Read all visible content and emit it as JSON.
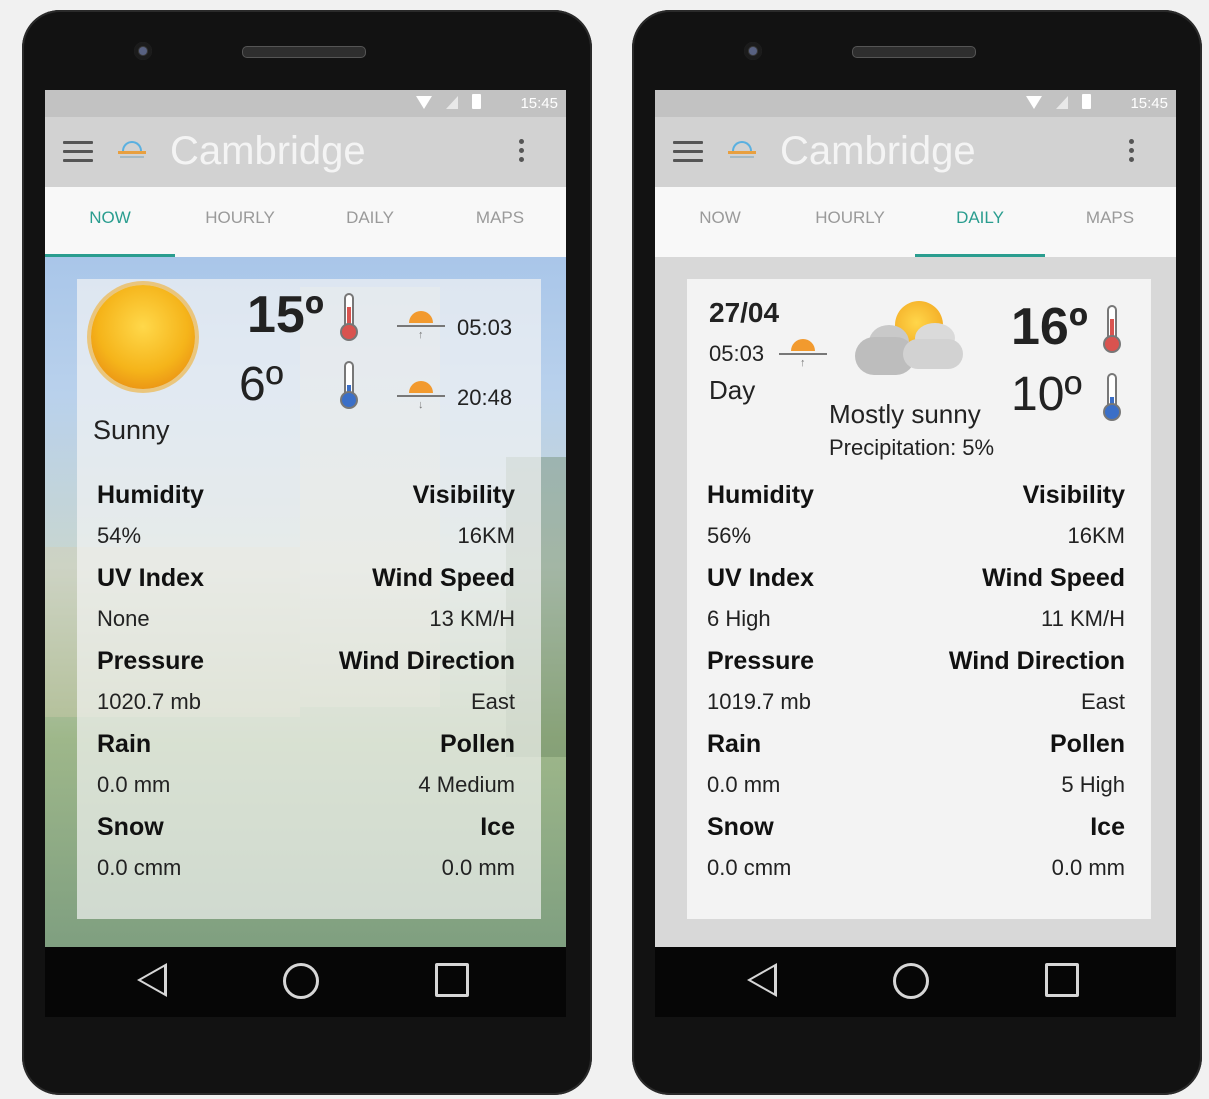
{
  "status": {
    "time": "15:45"
  },
  "app": {
    "title": "Cambridge"
  },
  "tabs": [
    {
      "label": "NOW"
    },
    {
      "label": "HOURLY"
    },
    {
      "label": "DAILY"
    },
    {
      "label": "MAPS"
    }
  ],
  "left": {
    "active_tab": "NOW",
    "condition": "Sunny",
    "temp_high": "15º",
    "temp_low": "6º",
    "sunrise": "05:03",
    "sunset": "20:48",
    "metrics": {
      "humidity": {
        "label": "Humidity",
        "value": "54%"
      },
      "visibility": {
        "label": "Visibility",
        "value": "16KM"
      },
      "uv": {
        "label": "UV Index",
        "value": "None"
      },
      "wind_speed": {
        "label": "Wind Speed",
        "value": "13 KM/H"
      },
      "pressure": {
        "label": "Pressure",
        "value": "1020.7 mb"
      },
      "wind_direction": {
        "label": "Wind Direction",
        "value": "East"
      },
      "rain": {
        "label": "Rain",
        "value": "0.0 mm"
      },
      "pollen": {
        "label": "Pollen",
        "value": "4 Medium"
      },
      "snow": {
        "label": "Snow",
        "value": "0.0 cmm"
      },
      "ice": {
        "label": "Ice",
        "value": "0.0 mm"
      }
    }
  },
  "right": {
    "active_tab": "DAILY",
    "date": "27/04",
    "sunrise": "05:03",
    "period": "Day",
    "condition": "Mostly sunny",
    "precipitation": "Precipitation: 5%",
    "temp_high": "16º",
    "temp_low": "10º",
    "metrics": {
      "humidity": {
        "label": "Humidity",
        "value": "56%"
      },
      "visibility": {
        "label": "Visibility",
        "value": "16KM"
      },
      "uv": {
        "label": "UV Index",
        "value": "6 High"
      },
      "wind_speed": {
        "label": "Wind Speed",
        "value": "11 KM/H"
      },
      "pressure": {
        "label": "Pressure",
        "value": "1019.7 mb"
      },
      "wind_direction": {
        "label": "Wind Direction",
        "value": "East"
      },
      "rain": {
        "label": "Rain",
        "value": "0.0 mm"
      },
      "pollen": {
        "label": "Pollen",
        "value": "5 High"
      },
      "snow": {
        "label": "Snow",
        "value": "0.0 cmm"
      },
      "ice": {
        "label": "Ice",
        "value": "0.0 mm"
      }
    }
  }
}
